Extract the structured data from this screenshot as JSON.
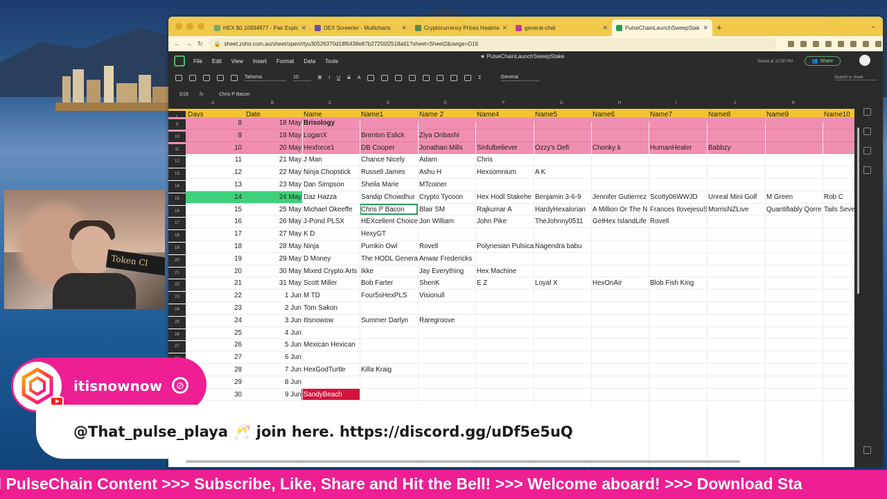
{
  "browser": {
    "tabs": [
      {
        "label": "HEX $0.10934977 - Pair Explo",
        "color": "#7aa86a"
      },
      {
        "label": "DEX Screener - Multicharts",
        "color": "#6b4fa8"
      },
      {
        "label": "Cryptocurrency Prices Heatma",
        "color": "#5a8a4a"
      },
      {
        "label": "general-chat",
        "color": "#c23a9a"
      },
      {
        "label": "PulseChainLaunchSweepStake",
        "color": "#2a9a5a"
      }
    ],
    "url": "sheet.zoho.com.au/sheet/open/rtyu30526370d18f6438e87b27255f2518a61?sheet=Sheet2&range=D16"
  },
  "app": {
    "doc_title": "PulseChainLaunchSweepStake",
    "menu": [
      "File",
      "Edit",
      "View",
      "Insert",
      "Format",
      "Data",
      "Tools"
    ],
    "saved_text": "Saved at 12:50 PM",
    "share_label": "Share",
    "font": "Tahoma",
    "font_size": "10",
    "format": "General",
    "search_placeholder": "Search in sheet",
    "name_box": "D16",
    "fx_label": "fx",
    "formula_value": "Chris P Bacon"
  },
  "sheet": {
    "column_letters": [
      "A",
      "B",
      "C",
      "D",
      "E",
      "F",
      "G",
      "H",
      "I",
      "J",
      "K"
    ],
    "header_row_num": "1",
    "headers": [
      "Days",
      "Date",
      "Name",
      "Name1",
      "Name 2",
      "Name4",
      "Name5",
      "Name6",
      "Name7",
      "Name8",
      "Name9",
      "Name10"
    ],
    "rows": [
      {
        "num": "9",
        "day": "8",
        "date": "18 May",
        "names": [
          "Brisology",
          "",
          "",
          "",
          "",
          "",
          "",
          "",
          "",
          ""
        ],
        "style": "pink"
      },
      {
        "num": "10",
        "day": "9",
        "date": "19 May",
        "names": [
          "LoganX",
          "Brenton Eslick",
          "Ziya Onbashi",
          "",
          "",
          "",
          "",
          "",
          "",
          ""
        ],
        "style": "pink"
      },
      {
        "num": "11",
        "day": "10",
        "date": "20 May",
        "names": [
          "Hexforce1",
          "DB Cooper",
          "Jonathan Mills",
          "Sinfulbeliever",
          "Ozzy's Defi",
          "Chonky k",
          "HumanHealer",
          "Babbzy",
          "",
          ""
        ],
        "style": "pink"
      },
      {
        "num": "12",
        "day": "11",
        "date": "21 May",
        "names": [
          "J Man",
          "Chance Nicely",
          "Adam",
          "Chris",
          "",
          "",
          "",
          "",
          "",
          ""
        ],
        "style": ""
      },
      {
        "num": "13",
        "day": "12",
        "date": "22 May",
        "names": [
          "Ninja Chopstick",
          "Russell James",
          "Ashu H",
          "Hexsomnium",
          "A K",
          "",
          "",
          "",
          "",
          ""
        ],
        "style": ""
      },
      {
        "num": "14",
        "day": "13",
        "date": "23 May",
        "names": [
          "Dan Simpson",
          "Sheila Marie",
          "MTcoiner",
          "",
          "",
          "",
          "",
          "",
          "",
          ""
        ],
        "style": ""
      },
      {
        "num": "15",
        "day": "14",
        "date": "24 May",
        "names": [
          "Daz Hazza",
          "Sandip Chowdhur",
          "Crypto Tycoon",
          "Hex Hodl Stakehe",
          "Benjamin 3-6-9",
          "Jennifer Gutierrez",
          "Scotty06WWJD",
          "Unreal Mini Golf",
          "M Green",
          "Rob C"
        ],
        "style": "green"
      },
      {
        "num": "16",
        "day": "15",
        "date": "25 May",
        "names": [
          "Michael Okeeffe",
          "Chris P Bacon",
          "Blair SM",
          "Rajkumar A",
          "HardyHexalorian",
          "A Million Or The N",
          "Frances IlovejesuS",
          "MorrisNZLive",
          "Quantifiably Qorre",
          "Tails Seve"
        ],
        "style": "selected"
      },
      {
        "num": "17",
        "day": "16",
        "date": "26 May",
        "names": [
          "J-Pond PLSX",
          "HEXcellent Choice",
          "Jon William",
          "John Pike",
          "TheJohnny0511",
          "GetHex IslandLife",
          "Rovell",
          "",
          "",
          ""
        ],
        "style": ""
      },
      {
        "num": "18",
        "day": "17",
        "date": "27 May",
        "names": [
          "K D",
          "HexyGT",
          "",
          "",
          "",
          "",
          "",
          "",
          "",
          ""
        ],
        "style": ""
      },
      {
        "num": "19",
        "day": "18",
        "date": "28 May",
        "names": [
          "Ninja",
          "Pumkin Owl",
          "Rovell",
          "Polynesian Pulsica",
          "Nagendra babu",
          "",
          "",
          "",
          "",
          ""
        ],
        "style": ""
      },
      {
        "num": "20",
        "day": "19",
        "date": "29 May",
        "names": [
          "D Money",
          "The HODL Genera",
          "Anwar Fredericks",
          "",
          "",
          "",
          "",
          "",
          "",
          ""
        ],
        "style": ""
      },
      {
        "num": "21",
        "day": "20",
        "date": "30 May",
        "names": [
          "Mixed Crypto Arts",
          "Ikke",
          "Jay Everything",
          "Hex Machine",
          "",
          "",
          "",
          "",
          "",
          ""
        ],
        "style": ""
      },
      {
        "num": "22",
        "day": "21",
        "date": "31 May",
        "names": [
          "Scott Miller",
          "Bob Farter",
          "ShenK",
          "E Z",
          "Loyal X",
          "HexOnAir",
          "Blob Fish King",
          "",
          "",
          ""
        ],
        "style": ""
      },
      {
        "num": "23",
        "day": "22",
        "date": "1 Jun",
        "names": [
          "M TD",
          "Four5sHexPLS",
          "Visionull",
          "",
          "",
          "",
          "",
          "",
          "",
          ""
        ],
        "style": ""
      },
      {
        "num": "24",
        "day": "23",
        "date": "2 Jun",
        "names": [
          "Tom Sakon",
          "",
          "",
          "",
          "",
          "",
          "",
          "",
          "",
          ""
        ],
        "style": ""
      },
      {
        "num": "25",
        "day": "24",
        "date": "3 Jun",
        "names": [
          "Itisnowow",
          "Summer Darlyn",
          "Raregroove",
          "",
          "",
          "",
          "",
          "",
          "",
          ""
        ],
        "style": ""
      },
      {
        "num": "26",
        "day": "25",
        "date": "4 Jun",
        "names": [
          "",
          "",
          "",
          "",
          "",
          "",
          "",
          "",
          "",
          ""
        ],
        "style": ""
      },
      {
        "num": "27",
        "day": "26",
        "date": "5 Jun",
        "names": [
          "Mexican Hexican",
          "",
          "",
          "",
          "",
          "",
          "",
          "",
          "",
          ""
        ],
        "style": ""
      },
      {
        "num": "28",
        "day": "27",
        "date": "6 Jun",
        "names": [
          "",
          "",
          "",
          "",
          "",
          "",
          "",
          "",
          "",
          ""
        ],
        "style": ""
      },
      {
        "num": "29",
        "day": "28",
        "date": "7 Jun",
        "names": [
          "HexGodTurtle",
          "Killa Kraig",
          "",
          "",
          "",
          "",
          "",
          "",
          "",
          ""
        ],
        "style": ""
      },
      {
        "num": "30",
        "day": "29",
        "date": "8 Jun",
        "names": [
          "",
          "",
          "",
          "",
          "",
          "",
          "",
          "",
          "",
          ""
        ],
        "style": ""
      },
      {
        "num": "31",
        "day": "30",
        "date": "9 Jun",
        "names": [
          "SandyBeach",
          "",
          "",
          "",
          "",
          "",
          "",
          "",
          "",
          ""
        ],
        "style": "red"
      }
    ]
  },
  "webcam": {
    "sign_text": "Token Cl"
  },
  "overlay": {
    "username": "itisnownow",
    "message": "@That_pulse_playa 🥂 join here. https://discord.gg/uDf5e5uQ",
    "ticker": "d PulseChain Content >>> Subscribe, Like, Share and Hit the Bell! >>> Welcome aboard! >>> Download Sta"
  },
  "colors": {
    "header_yellow": "#f3c431",
    "pink_row": "#f08fb2",
    "green_highlight": "#3ed07a",
    "red_cell": "#d4143c",
    "overlay_pink": "#ee1e93"
  }
}
